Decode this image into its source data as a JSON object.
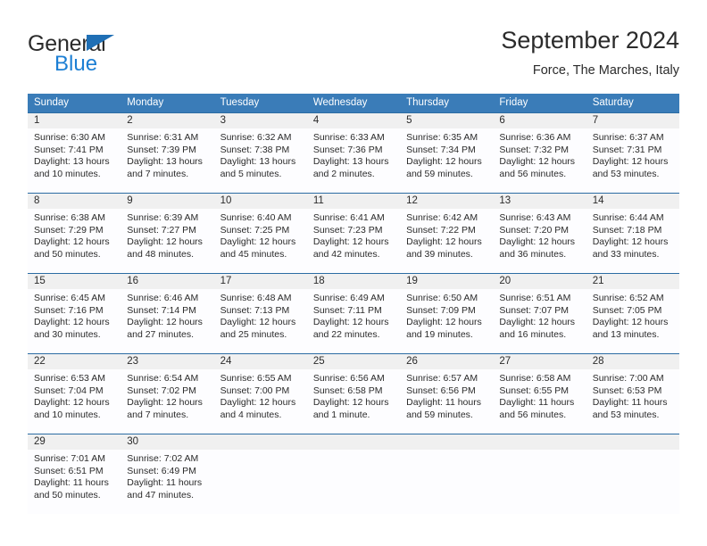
{
  "brand": {
    "word_one": "General",
    "word_two": "Blue"
  },
  "header": {
    "title": "September 2024",
    "location": "Force, The Marches, Italy"
  },
  "calendar": {
    "weekday_headers": [
      "Sunday",
      "Monday",
      "Tuesday",
      "Wednesday",
      "Thursday",
      "Friday",
      "Saturday"
    ],
    "colors": {
      "header_blue": "#3a7cb8",
      "separator_blue": "#2b6ca3",
      "date_band_gray": "#f0f0f0",
      "brand_blue": "#1c7fd4",
      "text": "#2b2b2b"
    },
    "weeks": [
      {
        "days": [
          {
            "date": "1",
            "sunrise": "Sunrise: 6:30 AM",
            "sunset": "Sunset: 7:41 PM",
            "daylight_line1": "Daylight: 13 hours",
            "daylight_line2": "and 10 minutes."
          },
          {
            "date": "2",
            "sunrise": "Sunrise: 6:31 AM",
            "sunset": "Sunset: 7:39 PM",
            "daylight_line1": "Daylight: 13 hours",
            "daylight_line2": "and 7 minutes."
          },
          {
            "date": "3",
            "sunrise": "Sunrise: 6:32 AM",
            "sunset": "Sunset: 7:38 PM",
            "daylight_line1": "Daylight: 13 hours",
            "daylight_line2": "and 5 minutes."
          },
          {
            "date": "4",
            "sunrise": "Sunrise: 6:33 AM",
            "sunset": "Sunset: 7:36 PM",
            "daylight_line1": "Daylight: 13 hours",
            "daylight_line2": "and 2 minutes."
          },
          {
            "date": "5",
            "sunrise": "Sunrise: 6:35 AM",
            "sunset": "Sunset: 7:34 PM",
            "daylight_line1": "Daylight: 12 hours",
            "daylight_line2": "and 59 minutes."
          },
          {
            "date": "6",
            "sunrise": "Sunrise: 6:36 AM",
            "sunset": "Sunset: 7:32 PM",
            "daylight_line1": "Daylight: 12 hours",
            "daylight_line2": "and 56 minutes."
          },
          {
            "date": "7",
            "sunrise": "Sunrise: 6:37 AM",
            "sunset": "Sunset: 7:31 PM",
            "daylight_line1": "Daylight: 12 hours",
            "daylight_line2": "and 53 minutes."
          }
        ]
      },
      {
        "days": [
          {
            "date": "8",
            "sunrise": "Sunrise: 6:38 AM",
            "sunset": "Sunset: 7:29 PM",
            "daylight_line1": "Daylight: 12 hours",
            "daylight_line2": "and 50 minutes."
          },
          {
            "date": "9",
            "sunrise": "Sunrise: 6:39 AM",
            "sunset": "Sunset: 7:27 PM",
            "daylight_line1": "Daylight: 12 hours",
            "daylight_line2": "and 48 minutes."
          },
          {
            "date": "10",
            "sunrise": "Sunrise: 6:40 AM",
            "sunset": "Sunset: 7:25 PM",
            "daylight_line1": "Daylight: 12 hours",
            "daylight_line2": "and 45 minutes."
          },
          {
            "date": "11",
            "sunrise": "Sunrise: 6:41 AM",
            "sunset": "Sunset: 7:23 PM",
            "daylight_line1": "Daylight: 12 hours",
            "daylight_line2": "and 42 minutes."
          },
          {
            "date": "12",
            "sunrise": "Sunrise: 6:42 AM",
            "sunset": "Sunset: 7:22 PM",
            "daylight_line1": "Daylight: 12 hours",
            "daylight_line2": "and 39 minutes."
          },
          {
            "date": "13",
            "sunrise": "Sunrise: 6:43 AM",
            "sunset": "Sunset: 7:20 PM",
            "daylight_line1": "Daylight: 12 hours",
            "daylight_line2": "and 36 minutes."
          },
          {
            "date": "14",
            "sunrise": "Sunrise: 6:44 AM",
            "sunset": "Sunset: 7:18 PM",
            "daylight_line1": "Daylight: 12 hours",
            "daylight_line2": "and 33 minutes."
          }
        ]
      },
      {
        "days": [
          {
            "date": "15",
            "sunrise": "Sunrise: 6:45 AM",
            "sunset": "Sunset: 7:16 PM",
            "daylight_line1": "Daylight: 12 hours",
            "daylight_line2": "and 30 minutes."
          },
          {
            "date": "16",
            "sunrise": "Sunrise: 6:46 AM",
            "sunset": "Sunset: 7:14 PM",
            "daylight_line1": "Daylight: 12 hours",
            "daylight_line2": "and 27 minutes."
          },
          {
            "date": "17",
            "sunrise": "Sunrise: 6:48 AM",
            "sunset": "Sunset: 7:13 PM",
            "daylight_line1": "Daylight: 12 hours",
            "daylight_line2": "and 25 minutes."
          },
          {
            "date": "18",
            "sunrise": "Sunrise: 6:49 AM",
            "sunset": "Sunset: 7:11 PM",
            "daylight_line1": "Daylight: 12 hours",
            "daylight_line2": "and 22 minutes."
          },
          {
            "date": "19",
            "sunrise": "Sunrise: 6:50 AM",
            "sunset": "Sunset: 7:09 PM",
            "daylight_line1": "Daylight: 12 hours",
            "daylight_line2": "and 19 minutes."
          },
          {
            "date": "20",
            "sunrise": "Sunrise: 6:51 AM",
            "sunset": "Sunset: 7:07 PM",
            "daylight_line1": "Daylight: 12 hours",
            "daylight_line2": "and 16 minutes."
          },
          {
            "date": "21",
            "sunrise": "Sunrise: 6:52 AM",
            "sunset": "Sunset: 7:05 PM",
            "daylight_line1": "Daylight: 12 hours",
            "daylight_line2": "and 13 minutes."
          }
        ]
      },
      {
        "days": [
          {
            "date": "22",
            "sunrise": "Sunrise: 6:53 AM",
            "sunset": "Sunset: 7:04 PM",
            "daylight_line1": "Daylight: 12 hours",
            "daylight_line2": "and 10 minutes."
          },
          {
            "date": "23",
            "sunrise": "Sunrise: 6:54 AM",
            "sunset": "Sunset: 7:02 PM",
            "daylight_line1": "Daylight: 12 hours",
            "daylight_line2": "and 7 minutes."
          },
          {
            "date": "24",
            "sunrise": "Sunrise: 6:55 AM",
            "sunset": "Sunset: 7:00 PM",
            "daylight_line1": "Daylight: 12 hours",
            "daylight_line2": "and 4 minutes."
          },
          {
            "date": "25",
            "sunrise": "Sunrise: 6:56 AM",
            "sunset": "Sunset: 6:58 PM",
            "daylight_line1": "Daylight: 12 hours",
            "daylight_line2": "and 1 minute."
          },
          {
            "date": "26",
            "sunrise": "Sunrise: 6:57 AM",
            "sunset": "Sunset: 6:56 PM",
            "daylight_line1": "Daylight: 11 hours",
            "daylight_line2": "and 59 minutes."
          },
          {
            "date": "27",
            "sunrise": "Sunrise: 6:58 AM",
            "sunset": "Sunset: 6:55 PM",
            "daylight_line1": "Daylight: 11 hours",
            "daylight_line2": "and 56 minutes."
          },
          {
            "date": "28",
            "sunrise": "Sunrise: 7:00 AM",
            "sunset": "Sunset: 6:53 PM",
            "daylight_line1": "Daylight: 11 hours",
            "daylight_line2": "and 53 minutes."
          }
        ]
      },
      {
        "days": [
          {
            "date": "29",
            "sunrise": "Sunrise: 7:01 AM",
            "sunset": "Sunset: 6:51 PM",
            "daylight_line1": "Daylight: 11 hours",
            "daylight_line2": "and 50 minutes."
          },
          {
            "date": "30",
            "sunrise": "Sunrise: 7:02 AM",
            "sunset": "Sunset: 6:49 PM",
            "daylight_line1": "Daylight: 11 hours",
            "daylight_line2": "and 47 minutes."
          },
          {
            "date": "",
            "sunrise": "",
            "sunset": "",
            "daylight_line1": "",
            "daylight_line2": ""
          },
          {
            "date": "",
            "sunrise": "",
            "sunset": "",
            "daylight_line1": "",
            "daylight_line2": ""
          },
          {
            "date": "",
            "sunrise": "",
            "sunset": "",
            "daylight_line1": "",
            "daylight_line2": ""
          },
          {
            "date": "",
            "sunrise": "",
            "sunset": "",
            "daylight_line1": "",
            "daylight_line2": ""
          },
          {
            "date": "",
            "sunrise": "",
            "sunset": "",
            "daylight_line1": "",
            "daylight_line2": ""
          }
        ]
      }
    ]
  }
}
